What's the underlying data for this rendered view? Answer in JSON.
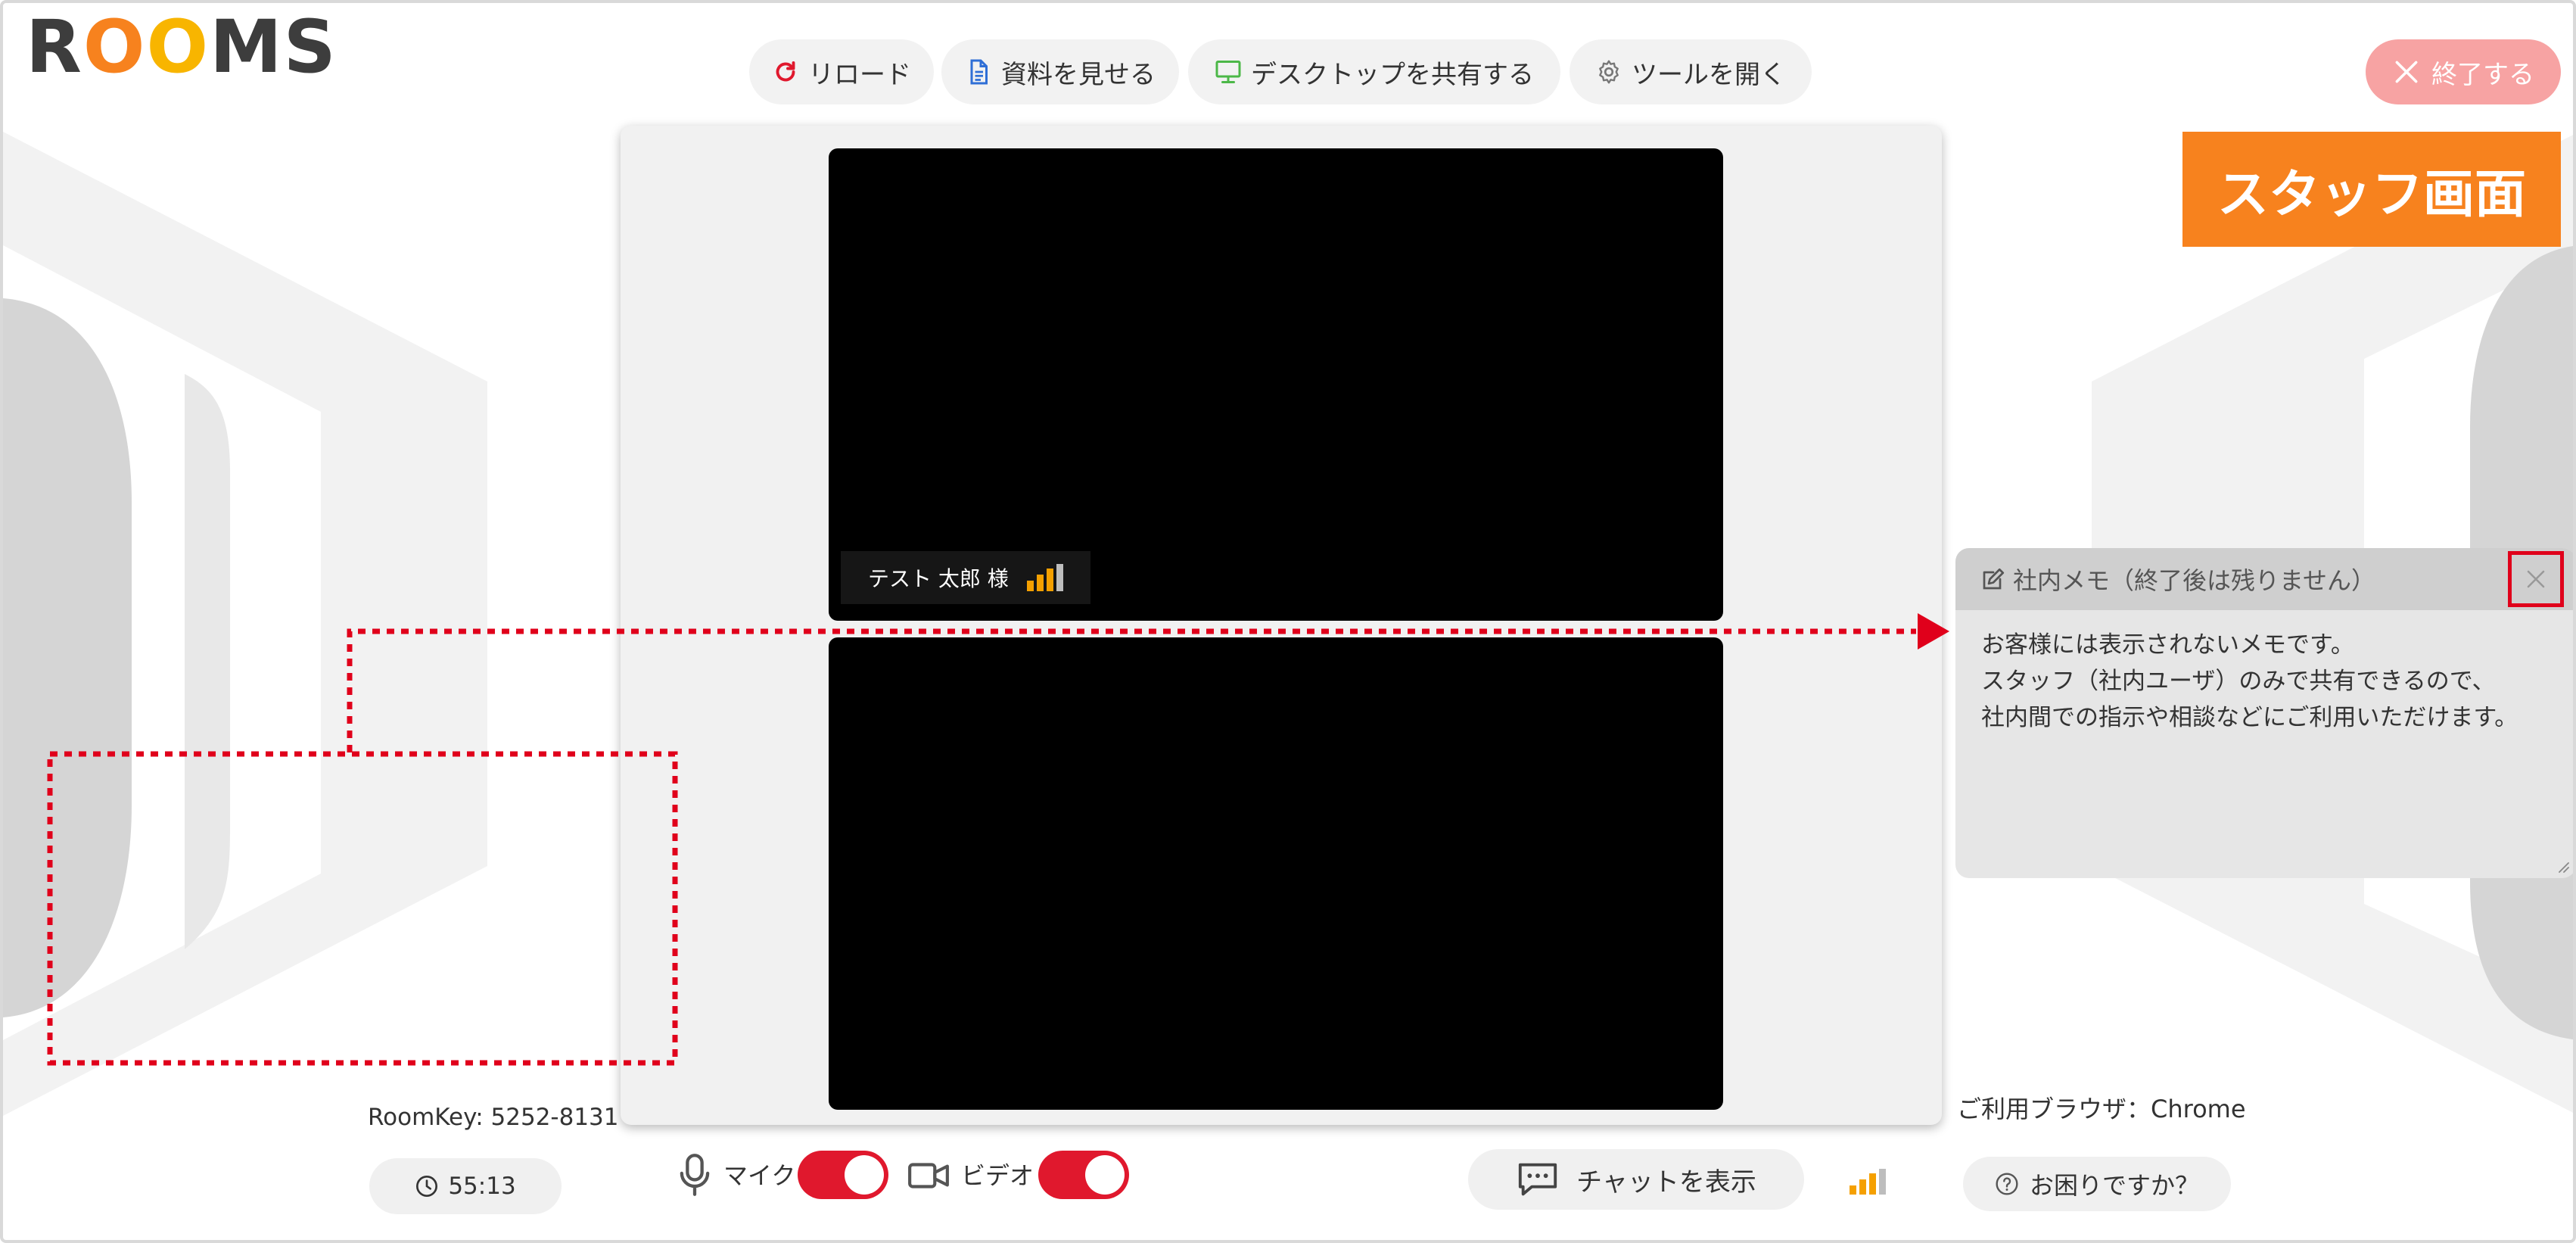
{
  "logo": {
    "text": "ROOMS",
    "letters": [
      {
        "char": "R",
        "color": "#3d3d3d"
      },
      {
        "char": "O",
        "color": "#f7821e"
      },
      {
        "char": "O",
        "color": "#f8b500"
      },
      {
        "char": "M",
        "color": "#3d3d3d"
      },
      {
        "char": "S",
        "color": "#3d3d3d"
      }
    ]
  },
  "toolbar": {
    "reload_label": "リロード",
    "documents_label": "資料を見せる",
    "share_desktop_label": "デスクトップを共有する",
    "tools_label": "ツールを開く"
  },
  "end_button": {
    "label": "終了する"
  },
  "staff_label": "スタッフ画面",
  "video": {
    "participant_name": "テスト 太郎 様"
  },
  "bottom": {
    "roomkey": "RoomKey: 5252-8131",
    "timer": "55:13",
    "mic_label": "マイク",
    "video_label": "ビデオ",
    "chat_label": "チャットを表示",
    "browser_info": "ご利用ブラウザ：Chrome",
    "help_label": "お困りですか？"
  },
  "memo": {
    "title": "社内メモ（終了後は残りません）",
    "lines": [
      "お客様には表示されないメモです。",
      "スタッフ（社内ユーザ）のみで共有できるので、",
      "社内間での指示や相談などにご利用いただけます。"
    ]
  },
  "colors": {
    "accent_orange": "#f7821e",
    "logo_yellow": "#f8b500",
    "toggle_red": "#e0182d",
    "end_button_pink": "#f7a3a3",
    "annotation_red": "#e0001b",
    "signal_orange": "#f5a000"
  }
}
